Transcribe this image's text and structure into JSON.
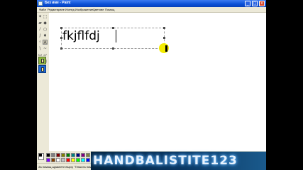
{
  "window": {
    "title": "Без име - Paint",
    "minimize_glyph": "_",
    "maximize_glyph": "□",
    "close_glyph": "x"
  },
  "menu": [
    "Файл",
    "Редактиране",
    "Изглед",
    "Изображение",
    "Цветове",
    "Помощ"
  ],
  "canvas": {
    "typed_text": "fkjflfdj"
  },
  "tools": [
    "free-select-icon",
    "rect-select-icon",
    "eraser-icon",
    "fill-icon",
    "color-picker-icon",
    "magnifier-icon",
    "pencil-icon",
    "brush-icon",
    "airbrush-icon",
    "text-icon",
    "line-icon",
    "curve-icon",
    "rectangle-icon",
    "polygon-icon",
    "ellipse-icon",
    "rounded-rect-icon"
  ],
  "palette": {
    "colors": [
      "#000000",
      "#808080",
      "#800000",
      "#808000",
      "#008000",
      "#008080",
      "#000080",
      "#800080",
      "#808040",
      "#004040",
      "#0080ff",
      "#004080",
      "#8000ff",
      "#804000",
      "#ffffff",
      "#c0c0c0",
      "#ff0000",
      "#ffff00",
      "#00ff00",
      "#00ffff",
      "#0000ff",
      "#ff00ff",
      "#ffff80",
      "#00ff80"
    ]
  },
  "status": {
    "text": "За помощ щракнете върху \"Тема на помощта\" в менюто Помощ."
  },
  "watermark": {
    "text": "HANDBALISTITE123"
  }
}
